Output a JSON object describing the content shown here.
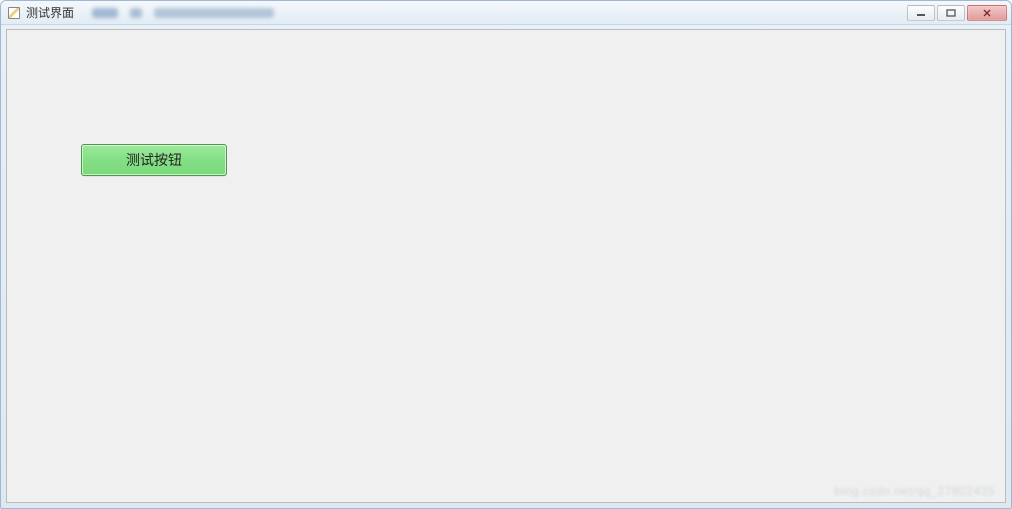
{
  "window": {
    "title": "测试界面"
  },
  "content": {
    "test_button_label": "测试按钮"
  },
  "controls": {
    "minimize_tooltip": "Minimize",
    "maximize_tooltip": "Maximize",
    "close_tooltip": "Close"
  },
  "watermark_text": "blog.csdn.net/qq_27802435"
}
